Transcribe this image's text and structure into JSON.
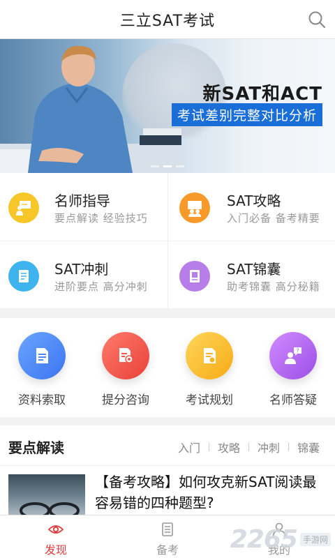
{
  "header": {
    "title": "三立SAT考试",
    "search_icon": "search-icon"
  },
  "banner": {
    "headline": "新SAT和ACT",
    "subline": "考试差别完整对比分析"
  },
  "features": [
    {
      "title": "名师指导",
      "subtitle": "要点解读  经验技巧",
      "icon": "teacher-icon",
      "color": "#f7c628"
    },
    {
      "title": "SAT攻略",
      "subtitle": "入门必备  备考精要",
      "icon": "strategy-icon",
      "color": "#f79a2a"
    },
    {
      "title": "SAT冲刺",
      "subtitle": "进阶要点  高分冲刺",
      "icon": "sprint-icon",
      "color": "#3fb3ee"
    },
    {
      "title": "SAT锦囊",
      "subtitle": "助考锦囊  高分秘籍",
      "icon": "tips-icon",
      "color": "#b77de8"
    }
  ],
  "quick": [
    {
      "label": "资料索取",
      "icon": "document-icon",
      "from": "#6aa6ff",
      "to": "#3b74f0"
    },
    {
      "label": "提分咨询",
      "icon": "consult-icon",
      "from": "#ff7b6a",
      "to": "#e9413a"
    },
    {
      "label": "考试规划",
      "icon": "plan-icon",
      "from": "#ffd65a",
      "to": "#f6ab16"
    },
    {
      "label": "名师答疑",
      "icon": "qa-icon",
      "from": "#d28bff",
      "to": "#9b4fe6"
    }
  ],
  "section": {
    "title": "要点解读",
    "tabs": [
      "入门",
      "攻略",
      "冲刺",
      "锦囊"
    ]
  },
  "article": {
    "title": "【备考攻略】如何攻克新SAT阅读最容易错的四种题型?"
  },
  "tabbar": [
    {
      "label": "发现",
      "icon": "eye-icon",
      "active": true
    },
    {
      "label": "备考",
      "icon": "list-icon",
      "active": false
    },
    {
      "label": "我的",
      "icon": "user-icon",
      "active": false
    }
  ],
  "watermark": {
    "number": "2265",
    "site": "手游网"
  },
  "colors": {
    "accent": "#e23b3b",
    "banner_blue": "#1a6ed8"
  }
}
